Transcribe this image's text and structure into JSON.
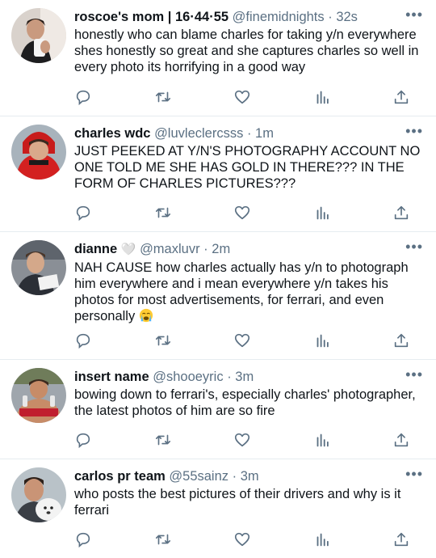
{
  "tweets": [
    {
      "name": "roscoe's mom | 16·44·55",
      "handle": "@finemidnights",
      "time": "32s",
      "text": "honestly who can blame charles for taking y/n everywhere shes honestly so great and she captures charles so well in every photo its horrifying in a good way",
      "avatar": "avatar-photo-roscoes-mom"
    },
    {
      "name": "charles wdc",
      "handle": "@luvleclercsss",
      "time": "1m",
      "text": "JUST PEEKED AT Y/N'S PHOTOGRAPHY ACCOUNT NO ONE TOLD ME SHE HAS GOLD IN THERE??? IN THE FORM OF CHARLES PICTURES???",
      "avatar": "avatar-photo-charles-wdc"
    },
    {
      "name": "dianne",
      "name_emoji": "🤍",
      "handle": "@maxluvr",
      "time": "2m",
      "text": "NAH CAUSE how charles actually has y/n to photograph him everywhere and i mean everywhere y/n takes his photos for most advertisements, for ferrari, and even personally",
      "text_emoji": "😭",
      "avatar": "avatar-photo-dianne"
    },
    {
      "name": "insert name",
      "handle": "@shooeyric",
      "time": "3m",
      "text": "bowing down to ferrari's, especially charles' photographer, the latest photos of him are so fire",
      "avatar": "avatar-photo-insert-name"
    },
    {
      "name": "carlos pr team",
      "handle": "@55sainz",
      "time": "3m",
      "text": "who posts the best pictures of their drivers and why is it ferrari",
      "avatar": "avatar-photo-carlos-pr-team"
    }
  ],
  "ui": {
    "separator": "·",
    "more": "•••"
  },
  "icons": [
    "reply-icon",
    "retweet-icon",
    "like-icon",
    "analytics-icon",
    "share-icon"
  ],
  "colors": {
    "text": "#0f1419",
    "secondary": "#5b7083",
    "divider": "#e6ecf0"
  }
}
